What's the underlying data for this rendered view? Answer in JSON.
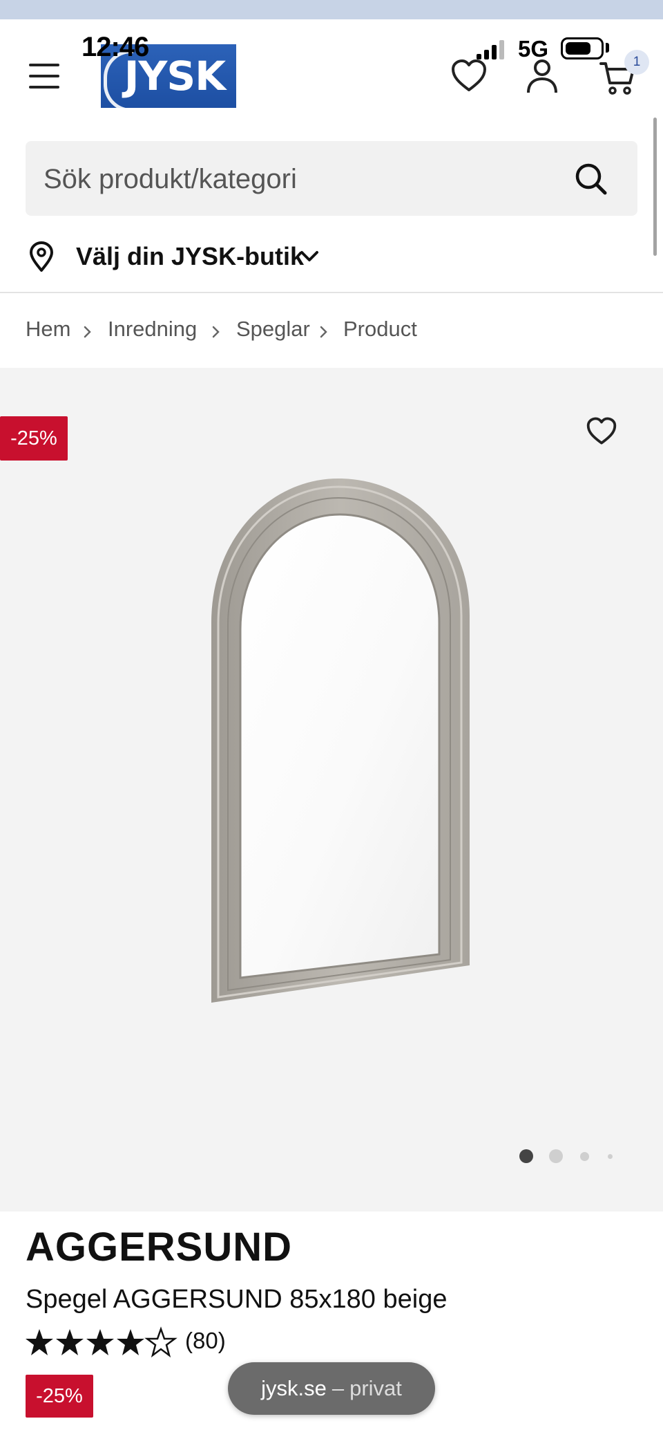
{
  "status_bar": {
    "time": "12:46",
    "network": "5G"
  },
  "header": {
    "logo_text": "JYSK",
    "icons": {
      "menu": "hamburger-menu-icon",
      "wishlist": "heart-icon",
      "account": "user-icon",
      "cart": "cart-icon"
    },
    "cart_count": "1"
  },
  "search": {
    "placeholder": "Sök produkt/kategori"
  },
  "store_selector": {
    "label": "Välj din JYSK-butik"
  },
  "breadcrumb": [
    "Hem",
    "Inredning",
    "Speglar",
    "Product"
  ],
  "product": {
    "discount": "-25%",
    "brand": "AGGERSUND",
    "title": "Spegel AGGERSUND 85x180 beige",
    "rating": 4,
    "rating_max": 5,
    "review_count": "(80)",
    "image_dots": 4,
    "active_image": 1
  },
  "browser_pill": {
    "domain": "jysk.se",
    "separator": "–",
    "mode": "privat"
  },
  "colors": {
    "brand_blue": "#1d4fa3",
    "discount_red": "#c8102e",
    "image_bg": "#f3f3f3"
  }
}
